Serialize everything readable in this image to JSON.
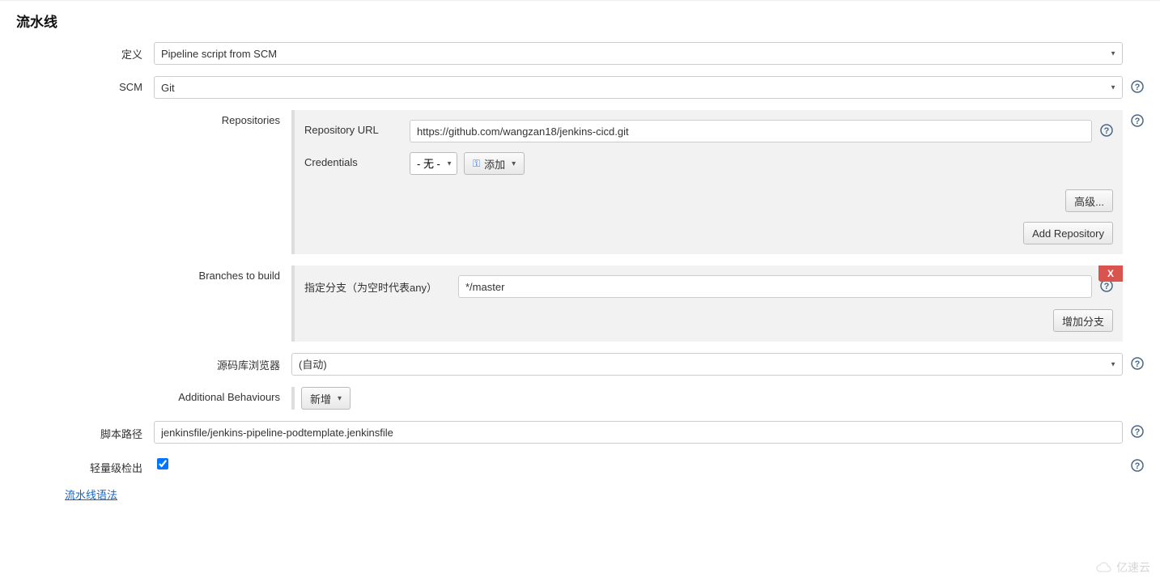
{
  "section_title": "流水线",
  "definition": {
    "label": "定义",
    "value": "Pipeline script from SCM"
  },
  "scm": {
    "label": "SCM",
    "value": "Git",
    "repositories": {
      "label": "Repositories",
      "repo_url_label": "Repository URL",
      "repo_url_value": "https://github.com/wangzan18/jenkins-cicd.git",
      "credentials_label": "Credentials",
      "credentials_value": "- 无 -",
      "add_button": "添加",
      "advanced_button": "高级...",
      "add_repo_button": "Add Repository"
    },
    "branches": {
      "label": "Branches to build",
      "branch_spec_label": "指定分支（为空时代表any）",
      "branch_spec_value": "*/master",
      "add_branch_button": "增加分支",
      "delete_label": "X"
    },
    "browser": {
      "label": "源码库浏览器",
      "value": "(自动)"
    },
    "behaviours": {
      "label": "Additional Behaviours",
      "add_button": "新增"
    }
  },
  "script_path": {
    "label": "脚本路径",
    "value": "jenkinsfile/jenkins-pipeline-podtemplate.jenkinsfile"
  },
  "lightweight": {
    "label": "轻量级检出",
    "checked": true
  },
  "syntax_link": "流水线语法",
  "watermark": "亿速云"
}
